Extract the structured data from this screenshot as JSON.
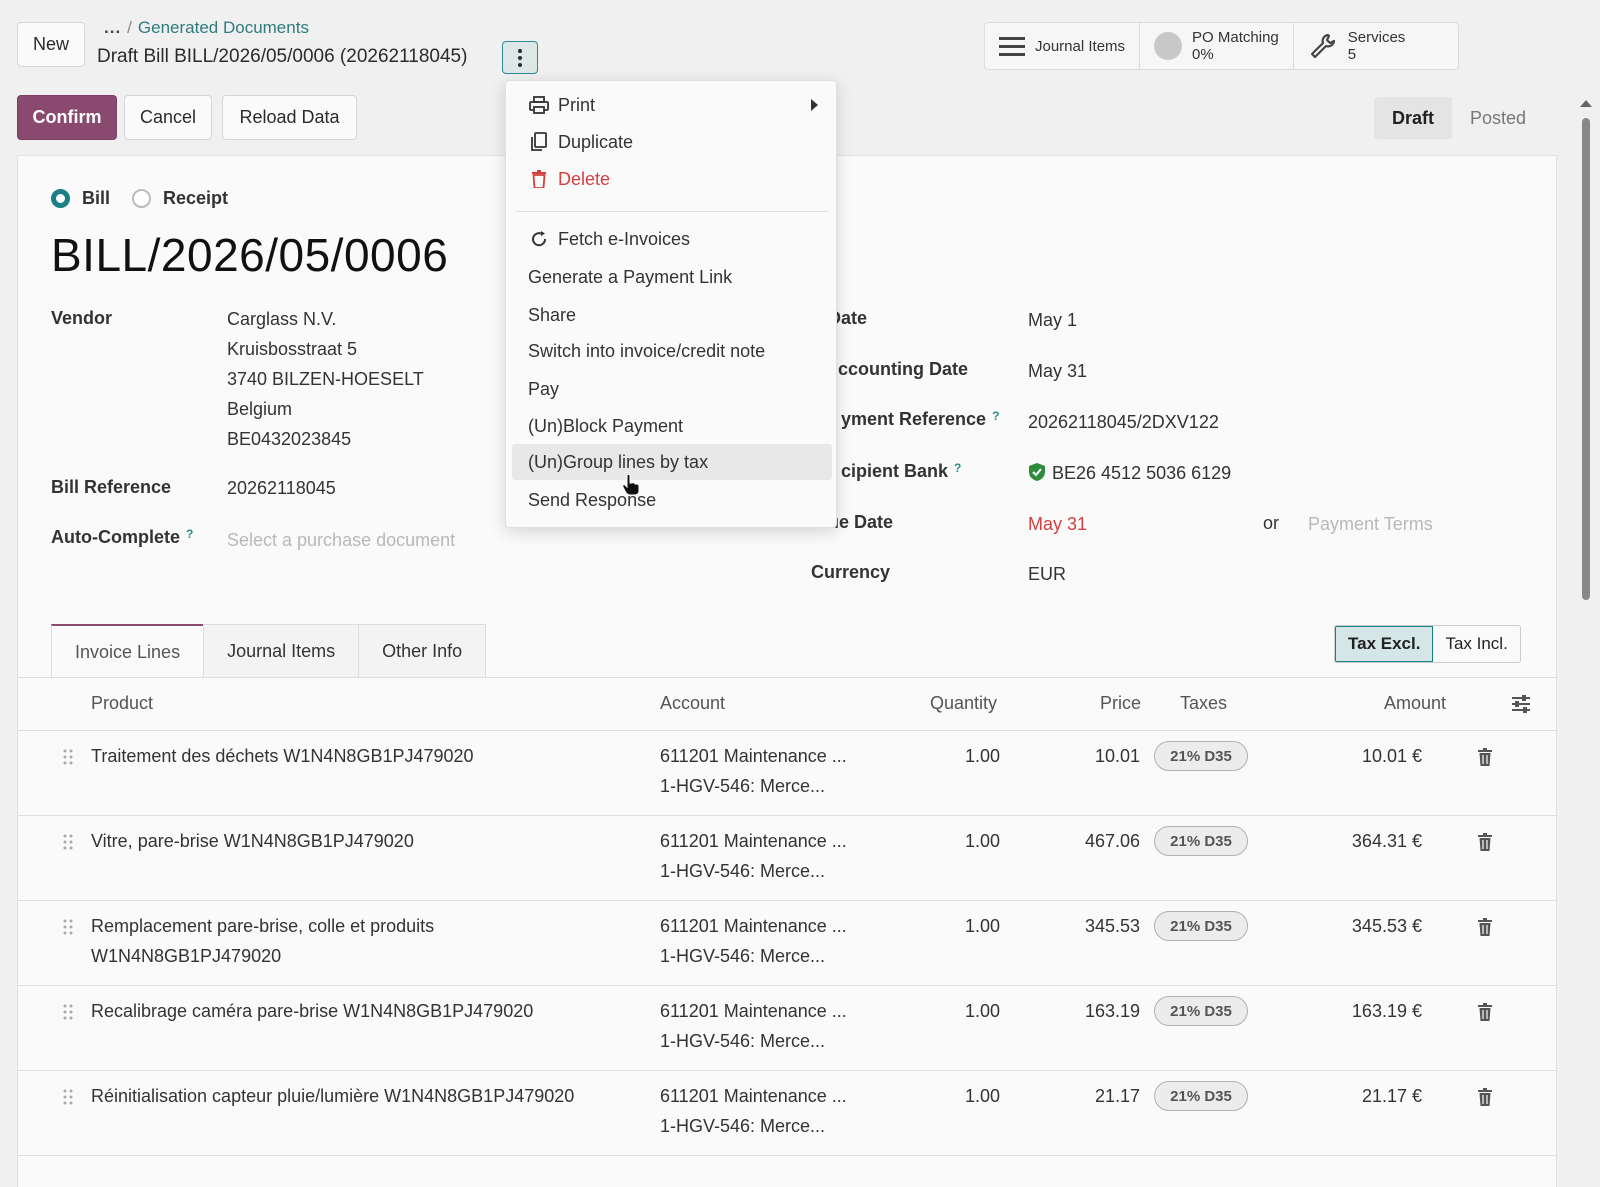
{
  "control": {
    "new_label": "New",
    "breadcrumb_dots": "...",
    "breadcrumb_parent": "Generated Documents",
    "record_title": "Draft Bill BILL/2026/05/0006 (20262118045)",
    "confirm_label": "Confirm",
    "cancel_label": "Cancel",
    "reload_label": "Reload Data"
  },
  "stats": {
    "journal_items": "Journal Items",
    "po_matching": "PO Matching",
    "po_matching_value": "0%",
    "services": "Services",
    "services_value": "5"
  },
  "status": {
    "draft": "Draft",
    "posted": "Posted",
    "active": "Draft"
  },
  "move_type": {
    "bill": "Bill",
    "receipt": "Receipt",
    "selected": "Bill"
  },
  "bill_name": "BILL/2026/05/0006",
  "left_fields": {
    "vendor_label": "Vendor",
    "vendor_name": "Carglass N.V.",
    "vendor_street": "Kruisbosstraat 5",
    "vendor_city": "3740 BILZEN-HOESELT",
    "vendor_country": "Belgium",
    "vendor_vat": "BE0432023845",
    "bill_ref_label": "Bill Reference",
    "bill_ref_value": "20262118045",
    "autocomplete_label": "Auto-Complete",
    "autocomplete_placeholder": "Select a purchase document",
    "help_mark": "?"
  },
  "right_fields": {
    "bill_date_label": "Date",
    "bill_date_value": "May 1",
    "accounting_date_label": "ccounting Date",
    "accounting_date_value": "May 31",
    "payment_ref_label": "yment Reference",
    "payment_ref_value": "20262118045/2DXV122",
    "recipient_bank_label": "cipient Bank",
    "recipient_bank_value": "BE26 4512 5036 6129",
    "due_date_label": "ue Date",
    "due_date_value": "May 31",
    "or_text": "or",
    "payment_terms_placeholder": "Payment Terms",
    "currency_label": "Currency",
    "currency_value": "EUR"
  },
  "tabs": [
    "Invoice Lines",
    "Journal Items",
    "Other Info"
  ],
  "tax_toggle": {
    "excl": "Tax Excl.",
    "incl": "Tax Incl."
  },
  "columns": {
    "product": "Product",
    "account": "Account",
    "quantity": "Quantity",
    "price": "Price",
    "taxes": "Taxes",
    "amount": "Amount"
  },
  "lines": [
    {
      "product1": "Traitement des déchets W1N4N8GB1PJ479020",
      "product2": "",
      "account1": "611201 Maintenance ...",
      "account2": "1-HGV-546: Merce...",
      "quantity": "1.00",
      "price": "10.01",
      "tax": "21% D35",
      "amount": "10.01 €"
    },
    {
      "product1": "Vitre, pare-brise W1N4N8GB1PJ479020",
      "product2": "",
      "account1": "611201 Maintenance ...",
      "account2": "1-HGV-546: Merce...",
      "quantity": "1.00",
      "price": "467.06",
      "tax": "21% D35",
      "amount": "364.31 €"
    },
    {
      "product1": "Remplacement pare-brise, colle et produits",
      "product2": "W1N4N8GB1PJ479020",
      "account1": "611201 Maintenance ...",
      "account2": "1-HGV-546: Merce...",
      "quantity": "1.00",
      "price": "345.53",
      "tax": "21% D35",
      "amount": "345.53 €"
    },
    {
      "product1": "Recalibrage caméra pare-brise W1N4N8GB1PJ479020",
      "product2": "",
      "account1": "611201 Maintenance ...",
      "account2": "1-HGV-546: Merce...",
      "quantity": "1.00",
      "price": "163.19",
      "tax": "21% D35",
      "amount": "163.19 €"
    },
    {
      "product1": "Réinitialisation capteur pluie/lumière W1N4N8GB1PJ479020",
      "product2": "",
      "account1": "611201 Maintenance ...",
      "account2": "1-HGV-546: Merce...",
      "quantity": "1.00",
      "price": "21.17",
      "tax": "21% D35",
      "amount": "21.17 €"
    }
  ],
  "menu": {
    "print": "Print",
    "duplicate": "Duplicate",
    "delete": "Delete",
    "fetch": "Fetch e-Invoices",
    "payment_link": "Generate a Payment Link",
    "share": "Share",
    "switch": "Switch into invoice/credit note",
    "pay": "Pay",
    "block": "(Un)Block Payment",
    "group": "(Un)Group lines by tax",
    "send": "Send Response",
    "highlighted": "(Un)Group lines by tax"
  },
  "colors": {
    "primary": "#8a4a6f",
    "accent": "#1b7f86",
    "danger": "#d44040"
  }
}
